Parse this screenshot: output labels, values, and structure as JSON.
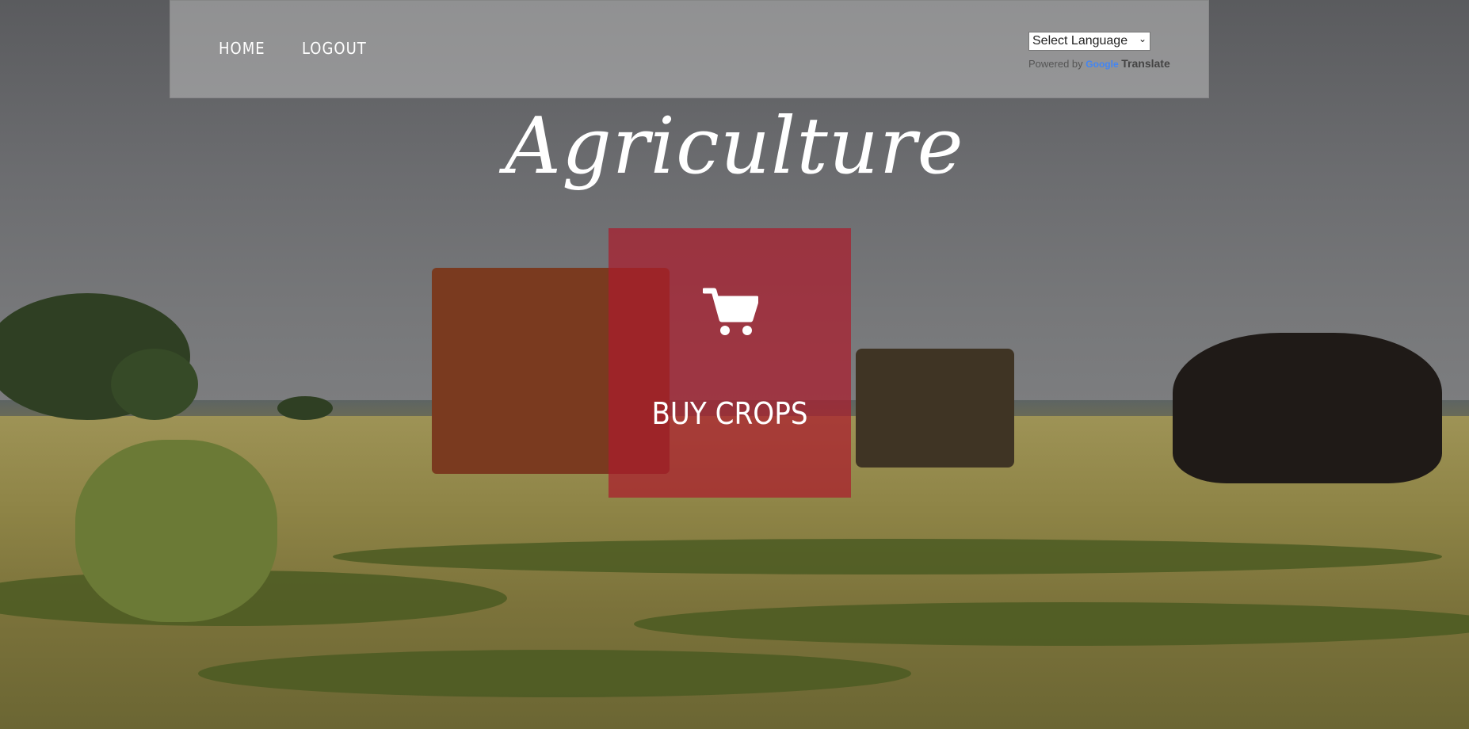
{
  "nav": {
    "home_label": "HOME",
    "logout_label": "LOGOUT"
  },
  "translate": {
    "select_label": "Select Language",
    "powered_by": "Powered by",
    "google": "Google",
    "translate_label": "Translate"
  },
  "hero": {
    "title": "Agriculture"
  },
  "buy": {
    "label": "BUY CROPS",
    "icon": "shopping-cart-icon",
    "color": "#aa1c2d"
  }
}
